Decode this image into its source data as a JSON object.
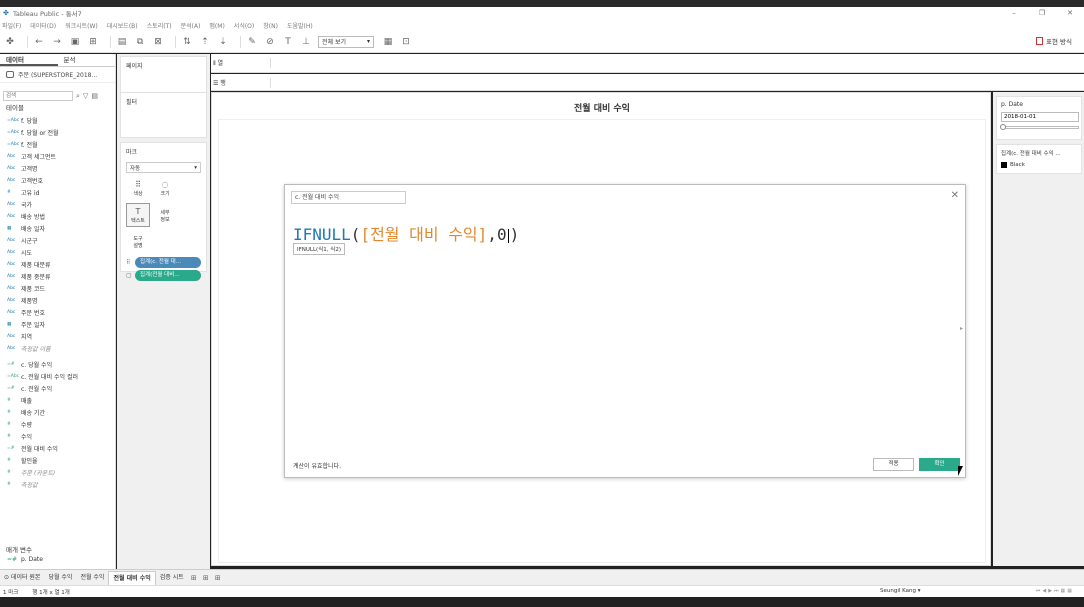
{
  "window": {
    "title": "Tableau Public - 통서7",
    "controls": [
      "–",
      "❐",
      "✕"
    ]
  },
  "menu": [
    "파일(F)",
    "데이터(D)",
    "워크시트(W)",
    "대시보드(B)",
    "스토리(T)",
    "분석(A)",
    "맵(M)",
    "서식(O)",
    "창(N)",
    "도움말(H)"
  ],
  "toolbar": {
    "fit_select": "전체 보기",
    "show_me": "표현 방식"
  },
  "left_panel": {
    "tab_data": "데이터",
    "tab_analysis": "분석",
    "datasource": "주문 (SUPERSTORE_2018...",
    "search_placeholder": "검색",
    "tables_header": "테이블",
    "fields": [
      {
        "type": "=Abc",
        "name": "f. 당월"
      },
      {
        "type": "=Abc",
        "name": "f. 당월 or 전월"
      },
      {
        "type": "=Abc",
        "name": "f. 전월"
      },
      {
        "type": "Abc",
        "name": "고객 세그먼트"
      },
      {
        "type": "Abc",
        "name": "고객명"
      },
      {
        "type": "Abc",
        "name": "고객번호"
      },
      {
        "type": "#",
        "name": "고유 id"
      },
      {
        "type": "Abc",
        "name": "국가"
      },
      {
        "type": "Abc",
        "name": "배송 방법"
      },
      {
        "type": "▦",
        "name": "배송 일자"
      },
      {
        "type": "Abc",
        "name": "시군구"
      },
      {
        "type": "Abc",
        "name": "시도"
      },
      {
        "type": "Abc",
        "name": "제품 대분류"
      },
      {
        "type": "Abc",
        "name": "제품 중분류"
      },
      {
        "type": "Abc",
        "name": "제품 코드"
      },
      {
        "type": "Abc",
        "name": "제품명"
      },
      {
        "type": "Abc",
        "name": "주문 번호"
      },
      {
        "type": "▦",
        "name": "주문 일자"
      },
      {
        "type": "Abc",
        "name": "지역"
      },
      {
        "type": "Abc",
        "name": "측정값 이름",
        "italic": true
      },
      {
        "type": "=#",
        "name": "c. 당월 수익",
        "measure": true
      },
      {
        "type": "=Abc",
        "name": "c. 전월 대비 수익 컬러",
        "measure": true
      },
      {
        "type": "=#",
        "name": "c. 전월 수익",
        "measure": true
      },
      {
        "type": "#",
        "name": "매출",
        "measure": true
      },
      {
        "type": "#",
        "name": "배송 기간",
        "measure": true
      },
      {
        "type": "#",
        "name": "수량",
        "measure": true
      },
      {
        "type": "#",
        "name": "수익",
        "measure": true
      },
      {
        "type": "=#",
        "name": "전월 대비 수익",
        "measure": true
      },
      {
        "type": "#",
        "name": "할인율",
        "measure": true
      },
      {
        "type": "#",
        "name": "주문 (카운트)",
        "measure": true,
        "italic": true
      },
      {
        "type": "#",
        "name": "측정값",
        "measure": true,
        "italic": true
      }
    ],
    "params_header": "매개 변수",
    "param_item": "p. Date"
  },
  "shelves": {
    "pages": "페이지",
    "filters": "필터",
    "marks": "마크",
    "mark_type": "자동",
    "mark_buttons": [
      {
        "icon": "⠿",
        "label": "색상"
      },
      {
        "icon": "◌",
        "label": "크기"
      },
      {
        "icon": "T",
        "label": "텍스트",
        "selected": true
      },
      {
        "icon": "",
        "label": "세부\n정보"
      },
      {
        "icon": "",
        "label": "도구\n설명"
      }
    ],
    "pill1": "집계(c. 전월 대...",
    "pill2": "집계(전월 대비...",
    "columns_label": "⦀ 열",
    "rows_label": "☰ 행"
  },
  "sheet": {
    "title": "전월 대비 수익"
  },
  "right_panel": {
    "param_title": "p. Date",
    "param_value": "2018-01-01",
    "legend_title": "집계(c. 전월 대비 수익 ...",
    "legend_item": "Black"
  },
  "dialog": {
    "name": "c. 전월 대비 수익",
    "formula_fn": "IFNULL",
    "formula_open": "(",
    "formula_field": "[전월 대비 수익]",
    "formula_sep": ",",
    "formula_num": "0",
    "formula_close": ")",
    "hint": "IFNULL(식1, 식2)",
    "status": "계산이 유효합니다.",
    "apply": "적용",
    "ok": "확인"
  },
  "tabs": {
    "datasource": "데이터 원본",
    "sheets": [
      {
        "name": "당월 수익"
      },
      {
        "name": "전월 수익"
      },
      {
        "name": "전월 대비 수익",
        "active": true
      },
      {
        "name": "검증 시트"
      }
    ]
  },
  "statusbar": {
    "marks": "1 마크",
    "rows": "행 1개 x 열 1개",
    "user": "Seungil Kang"
  }
}
